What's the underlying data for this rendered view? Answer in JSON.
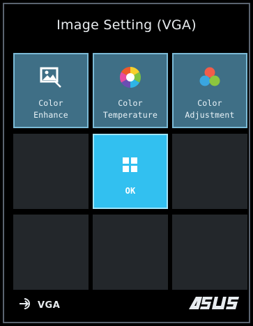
{
  "title": "Image Setting (VGA)",
  "tiles": [
    {
      "label": "Color\nEnhance",
      "icon": "picture-enhance-icon"
    },
    {
      "label": "Color\nTemperature",
      "icon": "color-wheel-icon"
    },
    {
      "label": "Color\nAdjustment",
      "icon": "rgb-circles-icon"
    }
  ],
  "ok": {
    "label": "OK",
    "icon": "grid-icon"
  },
  "footer": {
    "input_label": "VGA",
    "input_icon": "input-source-icon",
    "brand": "ASUS"
  },
  "colors": {
    "tile": "#3f6f86",
    "tile_border": "#7bbad6",
    "selected": "#32c0f0",
    "empty": "#23272b"
  }
}
